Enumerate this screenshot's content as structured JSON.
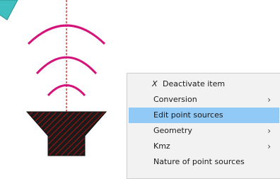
{
  "colors": {
    "antenna": "#d4147a",
    "base_fill": "#1a1a1a",
    "base_hatch": "#cc1111",
    "cyan_shape": "#3fbfbf",
    "menu_bg": "#f2f2f2",
    "menu_highlight": "#91c9f7"
  },
  "context_menu": {
    "items": [
      {
        "label": "Deactivate item",
        "icon": "X",
        "has_submenu": false
      },
      {
        "label": "Conversion",
        "has_submenu": true
      },
      {
        "label": "Edit point sources",
        "has_submenu": false,
        "highlighted": true
      },
      {
        "label": "Geometry",
        "has_submenu": true
      },
      {
        "label": "Kmz",
        "has_submenu": true
      },
      {
        "label": "Nature of point sources",
        "has_submenu": false
      }
    ],
    "submenu_glyph": "›"
  }
}
